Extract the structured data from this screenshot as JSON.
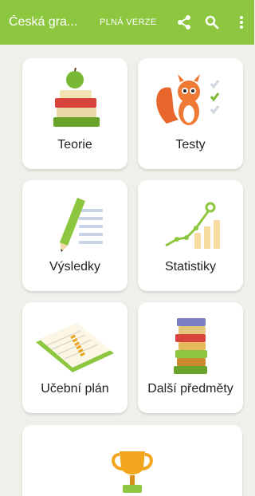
{
  "appbar": {
    "title": "Česká gra...",
    "full_version": "PLNÁ VERZE",
    "share_icon": "share-icon",
    "search_icon": "search-icon",
    "menu_icon": "more-vert-icon",
    "color": "#8dc63f"
  },
  "tiles": [
    {
      "label": "Teorie",
      "icon": "books-apple-icon"
    },
    {
      "label": "Testy",
      "icon": "squirrel-checklist-icon"
    },
    {
      "label": "Výsledky",
      "icon": "pencil-list-icon"
    },
    {
      "label": "Statistiky",
      "icon": "growth-chart-icon"
    },
    {
      "label": "Učební plán",
      "icon": "notebook-icon"
    },
    {
      "label": "Další předměty",
      "icon": "book-stack-icon"
    }
  ],
  "wide_tile": {
    "icon": "trophy-icon"
  }
}
